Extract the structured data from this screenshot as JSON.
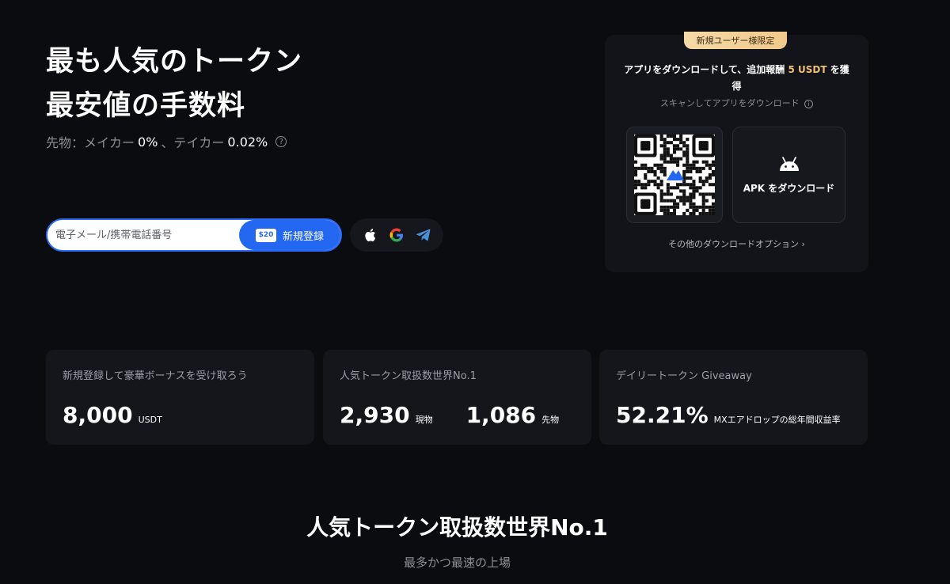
{
  "hero": {
    "title_line1": "最も人気のトークン",
    "title_line2": "最安値の手数料",
    "fees_prefix": "先物：メイカー",
    "maker_fee": "0%",
    "fees_mid": "、テイカー",
    "taker_fee": "0.02%"
  },
  "signup": {
    "placeholder": "電子メール/携帯電話番号",
    "button_label": "新規登録",
    "gift_badge": "$20"
  },
  "social": {
    "icons": [
      "apple-icon",
      "google-icon",
      "telegram-icon"
    ],
    "google_colors": [
      "#4285f4",
      "#ea4335",
      "#fbbc05",
      "#34a853"
    ],
    "telegram_color": "#4b8fd6"
  },
  "download": {
    "badge": "新規ユーザー様限定",
    "title_prefix": "アプリをダウンロードして、追加報酬",
    "reward": "5 USDT",
    "title_suffix": "を獲得",
    "subtitle": "スキャンしてアプリをダウンロード",
    "apk_label": "APK をダウンロード",
    "more_options": "その他のダウンロードオプション"
  },
  "stats": [
    {
      "label": "新規登録して豪華ボーナスを受け取ろう",
      "value": "8,000",
      "unit": "USDT"
    },
    {
      "label": "人気トークン取扱数世界No.1",
      "value": "2,930",
      "unit": "現物",
      "value2": "1,086",
      "unit2": "先物"
    },
    {
      "label": "デイリートークン Giveaway",
      "value": "52.21%",
      "unit": "MXエアドロップの総年間収益率"
    }
  ],
  "section": {
    "title": "人気トークン取扱数世界No.1",
    "subtitle": "最多かつ最速の上場"
  },
  "colors": {
    "accent": "#2468f2",
    "gold": "#f0c070",
    "background": "#0b0c0f"
  }
}
